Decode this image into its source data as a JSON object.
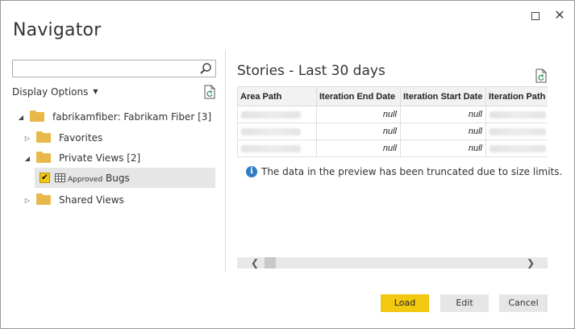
{
  "window": {
    "title": "Navigator",
    "maximize_label": "",
    "close_label": "✕"
  },
  "search": {
    "value": "",
    "placeholder": ""
  },
  "display_options": {
    "label": "Display Options",
    "chevron": "▼"
  },
  "tree": {
    "root": {
      "label": "fabrikamfiber: Fabrikam Fiber [3]",
      "expander": "◢"
    },
    "favorites": {
      "label": "Favorites",
      "expander": "▷"
    },
    "private_views": {
      "label": "Private Views [2]",
      "expander": "◢"
    },
    "approved_bugs": {
      "label_prefix": "Approved",
      "label_suffix": "Bugs",
      "checked": "✔"
    },
    "shared_views": {
      "label": "Shared Views",
      "expander": "▷"
    }
  },
  "preview": {
    "title": "Stories - Last 30 days",
    "columns": [
      "Area Path",
      "Iteration End Date",
      "Iteration Start Date",
      "Iteration Path"
    ],
    "rows": [
      [
        "",
        "null",
        "null",
        ""
      ],
      [
        "",
        "null",
        "null",
        ""
      ],
      [
        "",
        "null",
        "null",
        ""
      ]
    ],
    "info_message": "The data in the preview has been truncated due to size limits."
  },
  "scrollbar": {
    "left_arrow": "❮",
    "right_arrow": "❯"
  },
  "buttons": {
    "load": "Load",
    "edit": "Edit",
    "cancel": "Cancel"
  },
  "colors": {
    "accent": "#f2c811",
    "info": "#2f7cc4",
    "folder": "#e8b94a"
  },
  "icons": [
    "search-icon",
    "refresh-icon",
    "folder-icon",
    "table-icon",
    "info-icon",
    "close-icon",
    "maximize-icon"
  ]
}
